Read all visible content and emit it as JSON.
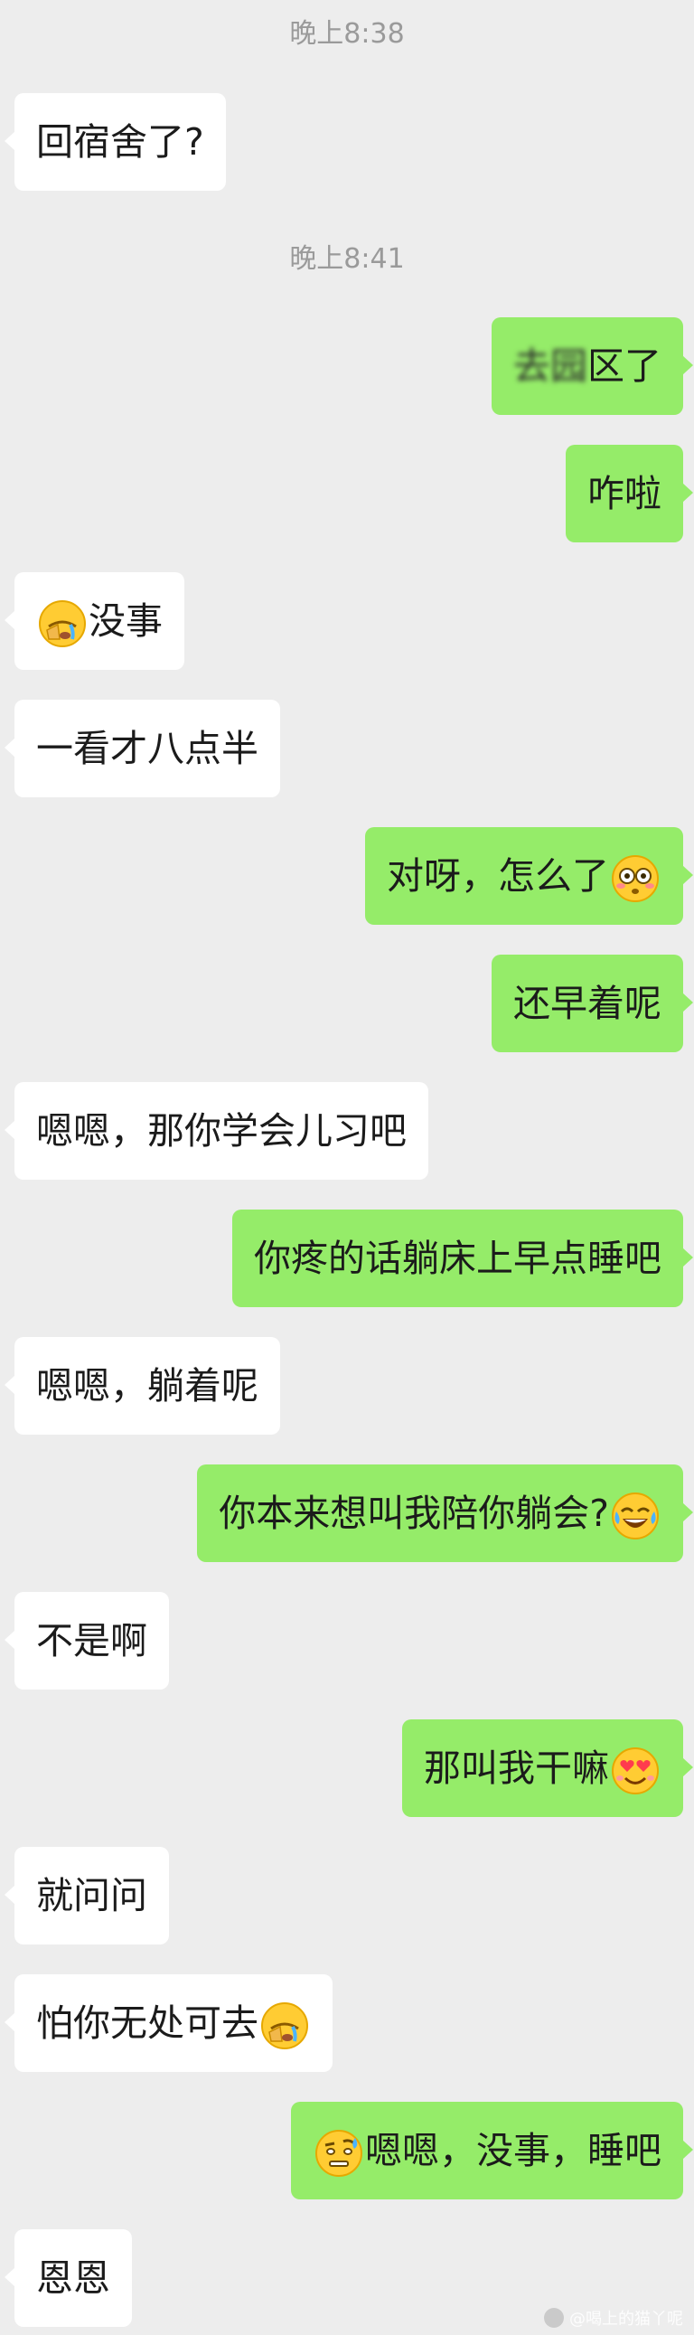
{
  "timestamps": [
    "晚上8:38",
    "晚上8:41"
  ],
  "messages": [
    {
      "text": "回宿舍了?"
    },
    {
      "text_blur_a": "去",
      "text_blur_b": "园",
      "text_tail": "区了"
    },
    {
      "text": "咋啦"
    },
    {
      "emoji": "face-with-hand-over-eye-crying-emoji",
      "text": "没事"
    },
    {
      "text": "一看才八点半"
    },
    {
      "text": "对呀，怎么了",
      "emoji": "flushed-face-emoji"
    },
    {
      "text": "还早着呢"
    },
    {
      "text": "嗯嗯，那你学会儿习吧"
    },
    {
      "text": "你疼的话躺床上早点睡吧"
    },
    {
      "text": "嗯嗯，躺着呢"
    },
    {
      "text": "你本来想叫我陪你躺会?",
      "emoji": "tears-of-joy-emoji"
    },
    {
      "text": "不是啊"
    },
    {
      "text": "那叫我干嘛",
      "emoji": "heart-eyes-emoji"
    },
    {
      "text": "就问问"
    },
    {
      "text": "怕你无处可去",
      "emoji": "face-with-hand-over-eye-crying-emoji"
    },
    {
      "emoji": "sweat-raised-eyebrow-emoji",
      "text": "嗯嗯，没事，睡吧"
    },
    {
      "text": "恩恩"
    }
  ],
  "watermark": {
    "text": "@喝上的猫丫呢"
  },
  "colors": {
    "background": "#ededed",
    "outgoing": "#95ec69",
    "incoming": "#ffffff",
    "timestamp": "#9a9a9a"
  }
}
